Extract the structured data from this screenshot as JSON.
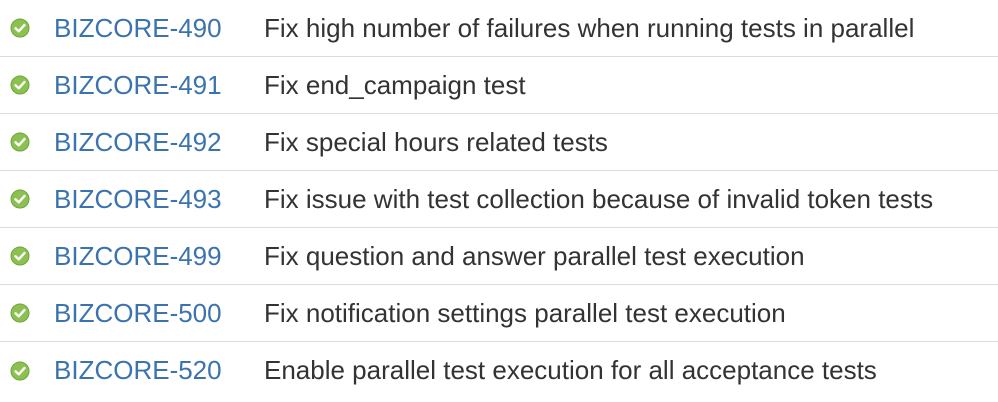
{
  "issues": [
    {
      "key": "BIZCORE-490",
      "summary": "Fix high number of failures when running tests in parallel",
      "status_icon": "check-circle-icon",
      "status_color": "#8cc152"
    },
    {
      "key": "BIZCORE-491",
      "summary": "Fix end_campaign test",
      "status_icon": "check-circle-icon",
      "status_color": "#8cc152"
    },
    {
      "key": "BIZCORE-492",
      "summary": "Fix special hours related tests",
      "status_icon": "check-circle-icon",
      "status_color": "#8cc152"
    },
    {
      "key": "BIZCORE-493",
      "summary": "Fix issue with test collection because of invalid token tests",
      "status_icon": "check-circle-icon",
      "status_color": "#8cc152"
    },
    {
      "key": "BIZCORE-499",
      "summary": "Fix question and answer parallel test execution",
      "status_icon": "check-circle-icon",
      "status_color": "#8cc152"
    },
    {
      "key": "BIZCORE-500",
      "summary": "Fix notification settings parallel test execution",
      "status_icon": "check-circle-icon",
      "status_color": "#8cc152"
    },
    {
      "key": "BIZCORE-520",
      "summary": "Enable parallel test execution for all acceptance tests",
      "status_icon": "check-circle-icon",
      "status_color": "#8cc152"
    }
  ],
  "colors": {
    "link": "#3b73af",
    "text": "#333333",
    "divider": "#dcdcdc"
  }
}
